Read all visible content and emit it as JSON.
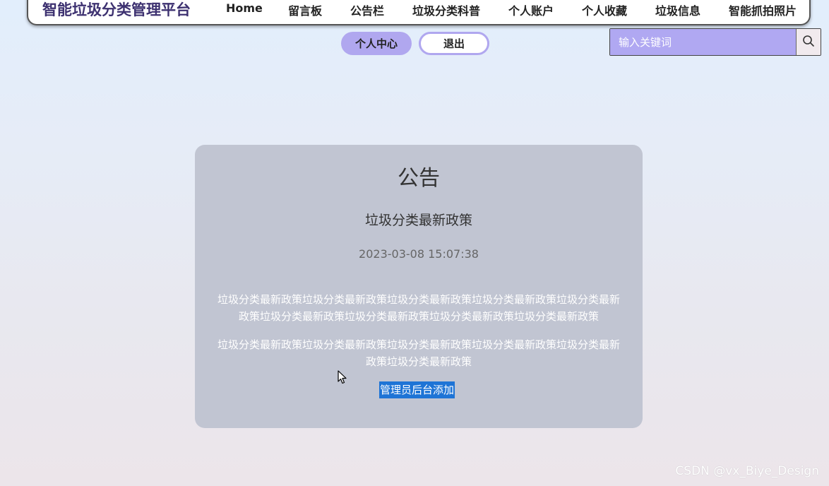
{
  "header": {
    "site_title": "智能垃圾分类管理平台",
    "nav": [
      {
        "label": "Home"
      },
      {
        "label": "留言板"
      },
      {
        "label": "公告栏"
      },
      {
        "label": "垃圾分类科普"
      },
      {
        "label": "个人账户"
      },
      {
        "label": "个人收藏"
      },
      {
        "label": "垃圾信息"
      },
      {
        "label": "智能抓拍照片"
      }
    ]
  },
  "user_actions": {
    "personal_center": "个人中心",
    "logout": "退出"
  },
  "search": {
    "placeholder": "输入关键词",
    "icon": "search-icon"
  },
  "notice": {
    "heading": "公告",
    "title": "垃圾分类最新政策",
    "date": "2023-03-08 15:07:38",
    "paragraphs": [
      "垃圾分类最新政策垃圾分类最新政策垃圾分类最新政策垃圾分类最新政策垃圾分类最新政策垃圾分类最新政策垃圾分类最新政策垃圾分类最新政策垃圾分类最新政策",
      "垃圾分类最新政策垃圾分类最新政策垃圾分类最新政策垃圾分类最新政策垃圾分类最新政策垃圾分类最新政策"
    ],
    "admin_note": "管理员后台添加"
  },
  "watermark": "CSDN @vx_Biye_Design",
  "colors": {
    "accent": "#b0a7ef",
    "title": "#3d3170",
    "card": "#c1c5d2",
    "selection": "#1e74d6"
  }
}
